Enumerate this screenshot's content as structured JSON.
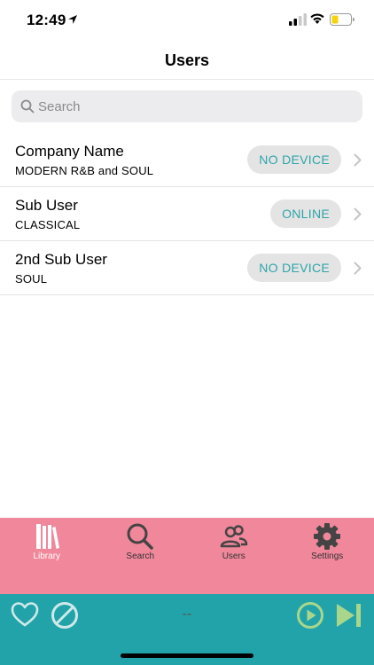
{
  "status_bar": {
    "time": "12:49"
  },
  "nav": {
    "title": "Users"
  },
  "search": {
    "placeholder": "Search"
  },
  "users": [
    {
      "name": "Company Name",
      "genre": "MODERN R&B and SOUL",
      "status": "NO DEVICE"
    },
    {
      "name": "Sub User",
      "genre": "CLASSICAL",
      "status": "ONLINE"
    },
    {
      "name": "2nd Sub User",
      "genre": "SOUL",
      "status": "NO DEVICE"
    }
  ],
  "tabs": [
    {
      "label": "Library",
      "icon": "library-icon",
      "active": true
    },
    {
      "label": "Search",
      "icon": "magnifier-icon",
      "active": false
    },
    {
      "label": "Users",
      "icon": "users-icon",
      "active": false
    },
    {
      "label": "Settings",
      "icon": "gear-icon",
      "active": false
    }
  ],
  "player": {
    "track": "--"
  },
  "colors": {
    "tab_bar": "#f0879b",
    "player_bar": "#22a3a9",
    "status_pill_text": "#2fa4aa",
    "player_controls": "#a9d68b"
  }
}
